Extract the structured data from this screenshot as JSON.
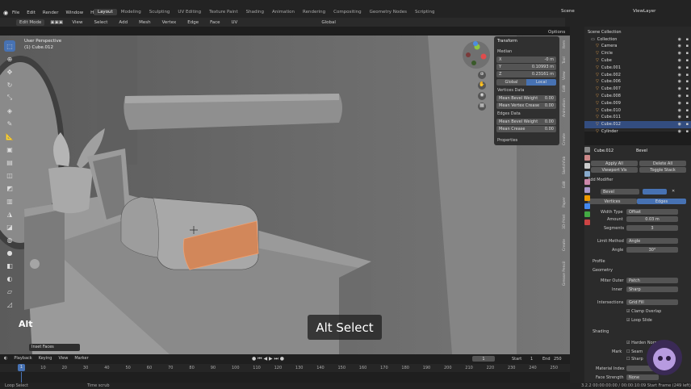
{
  "topbar": {
    "menus": [
      "File",
      "Edit",
      "Render",
      "Window",
      "Help"
    ],
    "workspaces": [
      "Layout",
      "Modeling",
      "Sculpting",
      "UV Editing",
      "Texture Paint",
      "Shading",
      "Animation",
      "Rendering",
      "Compositing",
      "Geometry Nodes",
      "Scripting"
    ],
    "active_workspace": "Layout",
    "scene_label": "Scene",
    "viewlayer_label": "ViewLayer"
  },
  "header": {
    "mode": "Edit Mode",
    "menus": [
      "View",
      "Select",
      "Add",
      "Mesh",
      "Vertex",
      "Edge",
      "Face",
      "UV"
    ],
    "orientation": "Global",
    "options": "Options"
  },
  "viewport": {
    "perspective": "User Perspective",
    "object": "(1) Cube.012",
    "overlay_key": "Alt",
    "caption": "Alt Select",
    "last_op": "Inset Faces"
  },
  "npanel": {
    "section": "Transform",
    "median": "Median",
    "x_label": "X",
    "x_val": "-0 m",
    "y_label": "Y",
    "y_val": "0.10993 m",
    "z_label": "Z",
    "z_val": "0.23161 m",
    "global": "Global",
    "local": "Local",
    "vertices_data": "Vertices Data",
    "mean_bevel_weight": "Mean Bevel Weight",
    "mbw_val": "0.00",
    "mean_vertex_crease": "Mean Vertex Crease",
    "mvc_val": "0.00",
    "edges_data": "Edges Data",
    "mean_bevel_weight2": "Mean Bevel Weight",
    "mbw2_val": "0.00",
    "mean_crease": "Mean Crease",
    "mc_val": "0.00",
    "properties": "Properties"
  },
  "side_tabs": [
    "Item",
    "Tool",
    "View",
    "Edit",
    "Animation",
    "Create",
    "Sketchfab",
    "Edit",
    "Paper",
    "3D-Print",
    "Create",
    "Grease Pencil",
    "Polygone"
  ],
  "outliner": {
    "title": "Scene Collection",
    "items": [
      "Collection",
      "Camera",
      "Circle",
      "Cube",
      "Cube.001",
      "Cube.002",
      "Cube.006",
      "Cube.007",
      "Cube.008",
      "Cube.009",
      "Cube.010",
      "Cube.011",
      "Cube.012",
      "Cylinder"
    ],
    "selected": "Cube.012"
  },
  "properties": {
    "object": "Cube.012",
    "modifier_type": "Bevel",
    "apply_all": "Apply All",
    "delete_all": "Delete All",
    "viewport_vis": "Viewport Vis",
    "toggle_stack": "Toggle Stack",
    "add_modifier": "Add Modifier",
    "modifier_name": "Bevel",
    "vertices": "Vertices",
    "edges": "Edges",
    "width_type_label": "Width Type",
    "width_type": "Offset",
    "amount_label": "Amount",
    "amount": "0.03 m",
    "segments_label": "Segments",
    "segments": "3",
    "limit_method_label": "Limit Method",
    "limit_method": "Angle",
    "angle_label": "Angle",
    "angle": "30°",
    "profile": "Profile",
    "geometry": "Geometry",
    "miter_outer_label": "Miter Outer",
    "miter_outer": "Patch",
    "inner_label": "Inner",
    "inner": "Sharp",
    "intersections_label": "Intersections",
    "intersections": "Grid Fill",
    "clamp_overlap": "Clamp Overlap",
    "loop_slide": "Loop Slide",
    "shading": "Shading",
    "harden_normals": "Harden Norm",
    "mark_label": "Mark",
    "seam": "Seam",
    "sharp": "Sharp",
    "material_index_label": "Material Index",
    "face_strength_label": "Face Strength",
    "face_strength": "None"
  },
  "timeline": {
    "menus": [
      "Playback",
      "Keying",
      "View",
      "Marker"
    ],
    "current_frame": "1",
    "start_label": "Start",
    "start": "1",
    "end_label": "End",
    "end": "250",
    "ticks": [
      "0",
      "10",
      "20",
      "30",
      "40",
      "50",
      "60",
      "70",
      "80",
      "90",
      "100",
      "110",
      "120",
      "130",
      "140",
      "150",
      "160",
      "170",
      "180",
      "190",
      "200",
      "210",
      "220",
      "230",
      "240",
      "250"
    ]
  },
  "status": {
    "left": "Loop Select",
    "mid": "Time scrub",
    "right": "3.2.2  00:00:00:00 / 00:00:10:09  Start Frame (249 left)"
  },
  "colors": {
    "accent": "#4772b3",
    "selected_face": "#d2875a",
    "viewport_bg": "#6e6e6e"
  }
}
